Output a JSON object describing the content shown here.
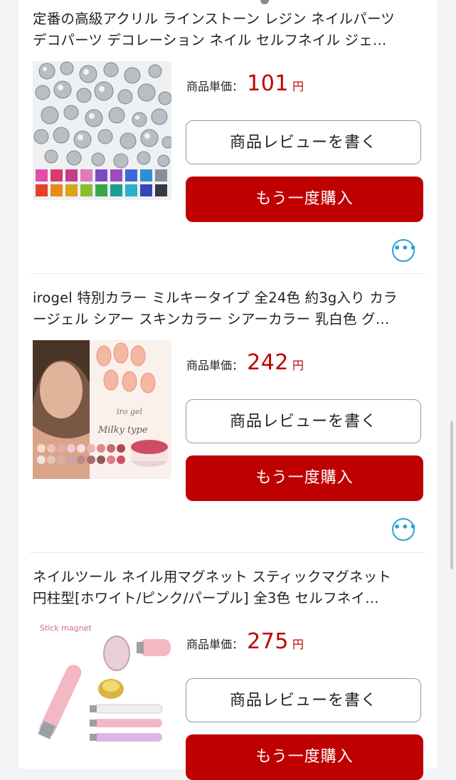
{
  "price_label": "商品単価：",
  "items": [
    {
      "title_line1": "定番の高級アクリル ラインストーン レジン ネイルパーツ",
      "title_line2": "デコパーツ デコレーション ネイル セルフネイル ジェ…",
      "price": "101",
      "unit": "円",
      "review_label": "商品レビューを書く",
      "buy_label": "もう一度購入",
      "more_label": "•••"
    },
    {
      "title_line1": "irogel 特別カラー ミルキータイプ 全24色 約3g入り カラ",
      "title_line2": "ージェル シアー スキンカラー シアーカラー 乳白色 グ…",
      "price": "242",
      "unit": "円",
      "review_label": "商品レビューを書く",
      "buy_label": "もう一度購入",
      "more_label": "•••"
    },
    {
      "title_line1": "ネイルツール ネイル用マグネット スティックマグネット",
      "title_line2": "円柱型[ホワイト/ピンク/パープル] 全3色 セルフネイ…",
      "price": "275",
      "unit": "円",
      "review_label": "商品レビューを書く",
      "buy_label": "もう一度購入"
    }
  ],
  "thumb_text": {
    "gel_brand": "iro gel",
    "gel_type": "Milky type",
    "magnet": "Stick magnet"
  },
  "colors": {
    "accent_red": "#bf0000",
    "link_blue": "#2aa1d8"
  }
}
